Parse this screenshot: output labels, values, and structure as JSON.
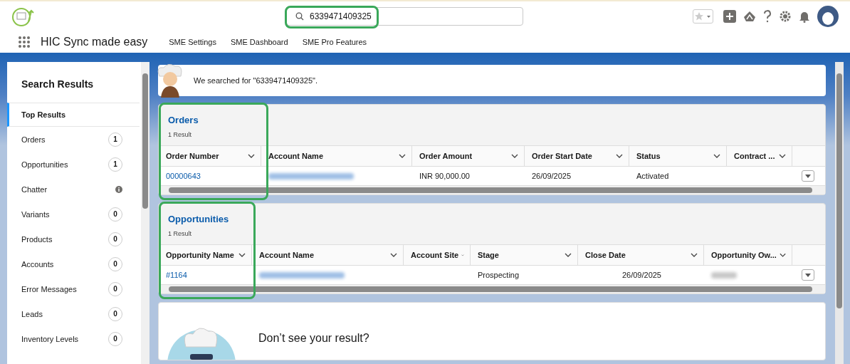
{
  "header": {
    "search": {
      "value": "6339471409325",
      "highlighted": true
    }
  },
  "nav": {
    "app_name": "HIC Sync made easy",
    "items": [
      "SME Settings",
      "SME Dashboard",
      "SME Pro Features"
    ]
  },
  "sidebar": {
    "title": "Search Results",
    "items": [
      {
        "label": "Top Results",
        "selected": true
      },
      {
        "label": "Orders",
        "selected": false,
        "kind": "count",
        "count": "1"
      },
      {
        "label": "Opportunities",
        "selected": false,
        "kind": "count",
        "count": "1"
      },
      {
        "label": "Chatter",
        "selected": false,
        "kind": "info"
      },
      {
        "label": "Variants",
        "selected": false,
        "kind": "count",
        "count": "0"
      },
      {
        "label": "Products",
        "selected": false,
        "kind": "count",
        "count": "0"
      },
      {
        "label": "Accounts",
        "selected": false,
        "kind": "count",
        "count": "0"
      },
      {
        "label": "Error Messages",
        "selected": false,
        "kind": "count",
        "count": "0"
      },
      {
        "label": "Leads",
        "selected": false,
        "kind": "count",
        "count": "0"
      },
      {
        "label": "Inventory Levels",
        "selected": false,
        "kind": "count",
        "count": "0"
      }
    ]
  },
  "banner": {
    "text": "We searched for \"6339471409325\"."
  },
  "sections": [
    {
      "title": "Orders",
      "result_count": "1 Result",
      "highlighted": true,
      "columns": [
        "Order Number",
        "Account Name",
        "Order Amount",
        "Order Start Date",
        "Status",
        "Contract ..."
      ],
      "rows": [
        [
          {
            "kind": "link",
            "text": "00000643"
          },
          {
            "kind": "redacted"
          },
          {
            "kind": "text",
            "text": "INR 90,000.00"
          },
          {
            "kind": "text",
            "text": "26/09/2025"
          },
          {
            "kind": "text",
            "text": "Activated"
          },
          {
            "kind": "text"
          }
        ]
      ]
    },
    {
      "title": "Opportunities",
      "result_count": "1 Result",
      "highlighted": true,
      "columns": [
        "Opportunity Name",
        "Account Name",
        "Account Site",
        "Stage",
        "Close Date",
        "Opportunity Ow..."
      ],
      "rows": [
        [
          {
            "kind": "link",
            "text": "#1164"
          },
          {
            "kind": "redacted"
          },
          {
            "kind": "text"
          },
          {
            "kind": "text",
            "text": "Prospecting"
          },
          {
            "kind": "number",
            "text": "26/09/2025"
          },
          {
            "kind": "redacted"
          }
        ]
      ]
    }
  ],
  "footer_card": {
    "text": "Don’t see your result?"
  }
}
